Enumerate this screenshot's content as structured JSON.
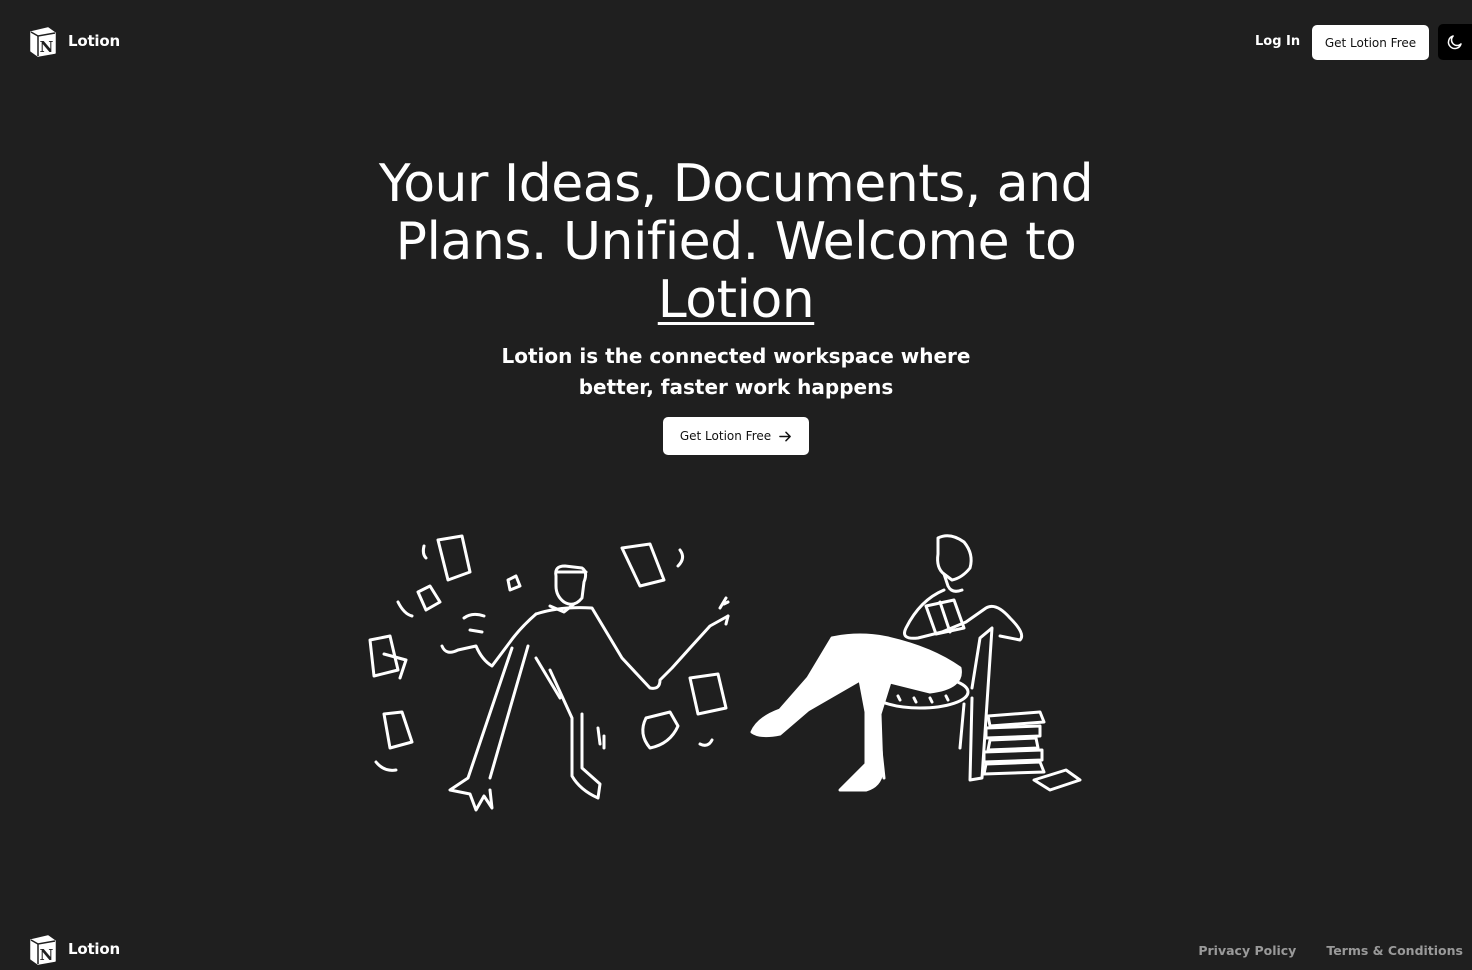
{
  "header": {
    "brand_name": "Lotion",
    "login_label": "Log In",
    "cta_label": "Get Lotion Free",
    "theme_toggle_icon": "moon-icon"
  },
  "hero": {
    "headline_prefix": "Your Ideas, Documents, and Plans. Unified. Welcome to",
    "headline_brand": "Lotion",
    "subheadline": "Lotion is the connected workspace where better, faster work happens",
    "cta_label": "Get Lotion Free",
    "cta_icon": "arrow-right-icon"
  },
  "footer": {
    "brand_name": "Lotion",
    "privacy_label": "Privacy Policy",
    "terms_label": "Terms & Conditions"
  },
  "colors": {
    "background": "#1f1f1f",
    "text": "#ffffff",
    "button_bg": "#ffffff",
    "footer_link": "#9a9a9a"
  }
}
